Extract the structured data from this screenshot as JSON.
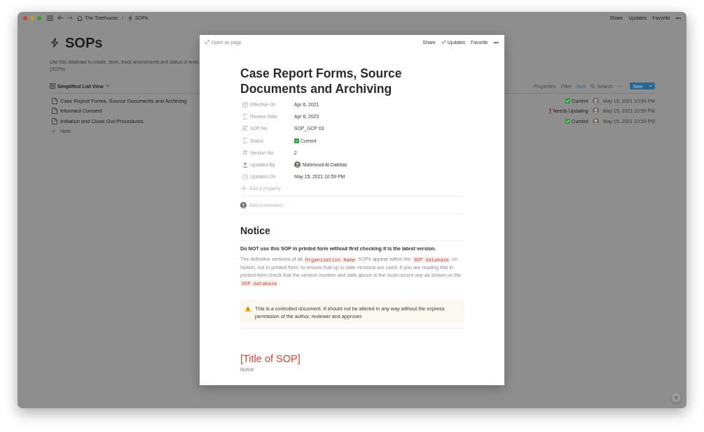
{
  "titlebar": {
    "breadcrumbs": [
      {
        "label": "The Treehouse"
      },
      {
        "label": "SOPs"
      }
    ],
    "separator": "/",
    "actions": [
      "Share",
      "Updates",
      "Favorite"
    ],
    "more": "•••"
  },
  "database": {
    "title": "SOPs",
    "description_lines": [
      "Use this database to create, store, track amendments and status of revie",
      "(SOPs)."
    ],
    "view": {
      "label": "Simplified List View"
    },
    "toolbar": [
      {
        "label": "Properties",
        "active": false
      },
      {
        "label": "Filter",
        "active": false
      },
      {
        "label": "Sort",
        "active": true
      },
      {
        "label": "Search",
        "active": false
      }
    ],
    "toolbar_more": "···",
    "new_button": "New",
    "rows": [
      {
        "title": "Case Report Forms, Source Documents and Archiving",
        "status": {
          "kind": "current",
          "label": "Current"
        },
        "updated": "May 15, 2021 10:59 PM"
      },
      {
        "title": "Informed Consent",
        "status": {
          "kind": "needs_update",
          "label": "Needs Updating"
        },
        "updated": "May 15, 2021 10:59 PM"
      },
      {
        "title": "Initiation and Close Out Procedures",
        "status": {
          "kind": "current",
          "label": "Current"
        },
        "updated": "May 15, 2021 10:59 PM"
      }
    ],
    "new_row": "New"
  },
  "modal": {
    "open_as_page": "Open as page",
    "actions": [
      {
        "label": "Share",
        "checked": false
      },
      {
        "label": "Updates",
        "checked": true
      },
      {
        "label": "Favorite",
        "checked": false
      }
    ],
    "more": "•••",
    "title": "Case Report Forms, Source Documents and Archiving",
    "properties": [
      {
        "kind": "date",
        "label": "Effective On",
        "value": "Apr 6, 2021"
      },
      {
        "kind": "formula",
        "label": "Review Date",
        "value": "Apr 6, 2023"
      },
      {
        "kind": "text",
        "label": "SOP No",
        "value": "SOP_GCP 03"
      },
      {
        "kind": "formula",
        "label": "Status",
        "value": {
          "kind": "current",
          "label": "Current"
        }
      },
      {
        "kind": "number",
        "label": "Version No",
        "value": "2"
      },
      {
        "kind": "person",
        "label": "Updated By",
        "value": "Mahmoud Al-Dabbas"
      },
      {
        "kind": "timestamp",
        "label": "Updated On",
        "value": "May 15, 2021 10:59 PM"
      }
    ],
    "add_property": "Add a property",
    "comment_placeholder": "Add a comment...",
    "notice_heading": "Notice",
    "warning_line": "Do NOT use this SOP in printed form without first checking it is the latest version.",
    "paragraph": [
      {
        "text": "The definitive versions of all ",
        "code": false
      },
      {
        "text": "Organisation Name",
        "code": true
      },
      {
        "text": " SOPs appear within the ",
        "code": false
      },
      {
        "text": "SOP database",
        "code": true
      },
      {
        "text": " on Notion, not in printed form, to ensure that up to date versions are used. If you are reading this in printed form check that the version number and date above is the most recent one as shown on the ",
        "code": false
      },
      {
        "text": "SOP database",
        "code": true
      },
      {
        "text": ".",
        "code": false
      }
    ],
    "callout": "This is a controlled document. It should not be altered in any way without the express permission of the author, reviewer and approver.",
    "section_title": "[Title of SOP]",
    "section_note": "Notice"
  },
  "help_button": "?"
}
